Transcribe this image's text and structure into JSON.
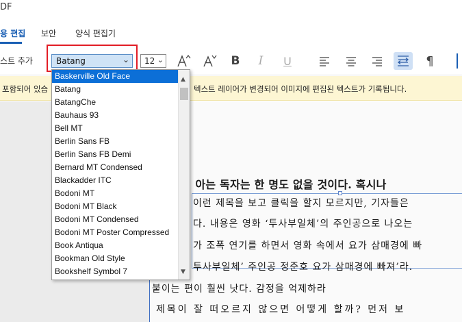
{
  "title_fragment": "DF",
  "tabs": [
    {
      "label": "용 편집",
      "active": true
    },
    {
      "label": "보안",
      "active": false
    },
    {
      "label": "양식 편집기",
      "active": false
    }
  ],
  "toolbar": {
    "add_text_label": "스트 추가",
    "font_value": "Batang",
    "size_value": "12",
    "buttons": [
      {
        "name": "increase-font-size",
        "icon": "font-increase-icon",
        "glyph": "A"
      },
      {
        "name": "decrease-font-size",
        "icon": "font-decrease-icon",
        "glyph": "A"
      },
      {
        "name": "bold",
        "icon": "bold-icon",
        "glyph": "B"
      },
      {
        "name": "italic",
        "icon": "italic-icon",
        "glyph": "I"
      },
      {
        "name": "underline",
        "icon": "underline-icon",
        "glyph": "U"
      },
      {
        "name": "align-left",
        "icon": "align-left-icon",
        "glyph": "≡"
      },
      {
        "name": "align-center",
        "icon": "align-center-icon",
        "glyph": "≡"
      },
      {
        "name": "align-right",
        "icon": "align-right-icon",
        "glyph": "≡"
      },
      {
        "name": "text-flow",
        "icon": "text-flow-icon",
        "glyph": "⇆",
        "selected": true
      },
      {
        "name": "paragraph-direction",
        "icon": "paragraph-icon",
        "glyph": "¶"
      }
    ]
  },
  "notice": {
    "left_text": "포함되어 있습",
    "right_text": "텍스트 레이어가 변경되어 이미지에 편집된 텍스트가 기록됩니다."
  },
  "font_dropdown": {
    "items": [
      "Baskerville Old Face",
      "Batang",
      "BatangChe",
      "Bauhaus 93",
      "Bell MT",
      "Berlin Sans FB",
      "Berlin Sans FB Demi",
      "Bernard MT Condensed",
      "Blackadder ITC",
      "Bodoni MT",
      "Bodoni MT Black",
      "Bodoni MT Condensed",
      "Bodoni MT Poster Compressed",
      "Book Antiqua",
      "Bookman Old Style",
      "Bookshelf Symbol 7"
    ],
    "highlighted_index": 0
  },
  "document": {
    "heading": "뜻하는지 아는 독자는 한 명도 없을 것이다. 혹시나",
    "lines": [
      "이런 제목을 보고 클릭을 할지 모르지만, 기자들은",
      "다. 내용은 영화 ‘투사부일체’의 주인공으로 나오는",
      "가 조폭 연기를 하면서 영화 속에서 요가 삼매경에 빠",
      "투사부일체’ 주인공 정준호 요가 삼매경에 빠져’라.",
      "붙이는 편이 훨씬 낫다. 감정을 억제하라",
      "제목이 잘 떠오르지 않으면 어떻게 할까? 먼저 보"
    ]
  },
  "colors": {
    "accent": "#1a5fb4",
    "highlight_blue": "#0c6fd7",
    "notice_bg": "#fdf6d3",
    "callout_red": "#e21d26"
  }
}
